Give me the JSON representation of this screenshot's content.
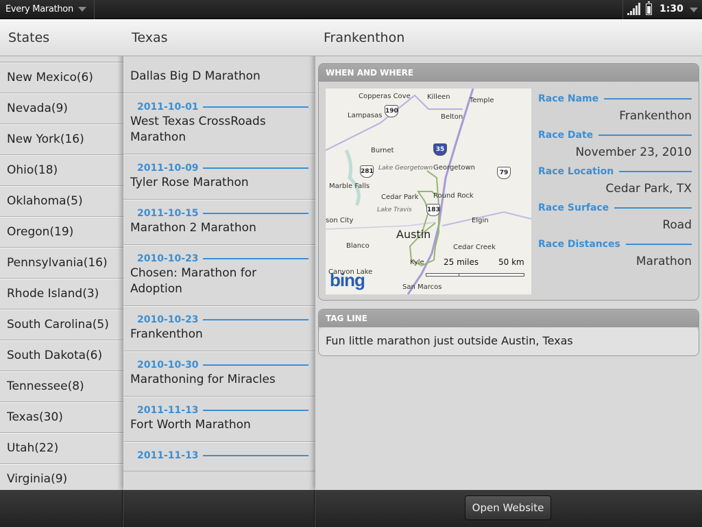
{
  "topbar": {
    "app_title": "Every Marathon",
    "clock": "1:30",
    "icons": [
      "signal-icon",
      "battery-icon",
      "chevron-down-icon"
    ]
  },
  "states": {
    "header": "States",
    "items": [
      "New Mexico(6)",
      "Nevada(9)",
      "New York(16)",
      "Ohio(18)",
      "Oklahoma(5)",
      "Oregon(19)",
      "Pennsylvania(16)",
      "Rhode Island(3)",
      "South Carolina(5)",
      "South Dakota(6)",
      "Tennessee(8)",
      "Texas(30)",
      "Utah(22)",
      "Virginia(9)"
    ]
  },
  "races": {
    "header": "Texas",
    "items": [
      {
        "date": "",
        "title": "Dallas Big D Marathon"
      },
      {
        "date": "2011-10-01",
        "title": "West Texas CrossRoads Marathon"
      },
      {
        "date": "2011-10-09",
        "title": "Tyler Rose Marathon"
      },
      {
        "date": "2011-10-15",
        "title": "Marathon 2 Marathon"
      },
      {
        "date": "2010-10-23",
        "title": "Chosen: Marathon for Adoption"
      },
      {
        "date": "2010-10-23",
        "title": "Frankenthon"
      },
      {
        "date": "2010-10-30",
        "title": "Marathoning for Miracles"
      },
      {
        "date": "2011-11-13",
        "title": "Fort Worth Marathon"
      },
      {
        "date": "2011-11-13",
        "title": ""
      }
    ]
  },
  "detail": {
    "header": "Frankenthon",
    "when_where": {
      "title": "WHEN AND WHERE",
      "fields": [
        {
          "label": "Race Name",
          "value": "Frankenthon"
        },
        {
          "label": "Race Date",
          "value": "November 23, 2010"
        },
        {
          "label": "Race Location",
          "value": "Cedar Park, TX"
        },
        {
          "label": "Race Surface",
          "value": "Road"
        },
        {
          "label": "Race Distances",
          "value": "Marathon"
        }
      ]
    },
    "map": {
      "places": [
        "Copperas Cove",
        "Killeen",
        "Temple",
        "Lampasas",
        "Belton",
        "Burnet",
        "Lake Georgetown",
        "Georgetown",
        "Marble Falls",
        "Cedar Park",
        "Round Rock",
        "Lake Travis",
        "son City",
        "Elgin",
        "Austin",
        "Blanco",
        "Cedar Creek",
        "Kyle",
        "Canyon Lake",
        "San Marcos"
      ],
      "shields": [
        "190",
        "35",
        "281",
        "79",
        "183"
      ],
      "scale_miles": "25 miles",
      "scale_km": "50 km",
      "logo": "bing"
    },
    "tag_line": {
      "title": "TAG LINE",
      "text": "Fun little marathon just outside Austin, Texas"
    }
  },
  "bottom": {
    "open_website": "Open Website"
  },
  "colors": {
    "accent": "#3a8fd6",
    "topbar": "#222222"
  }
}
